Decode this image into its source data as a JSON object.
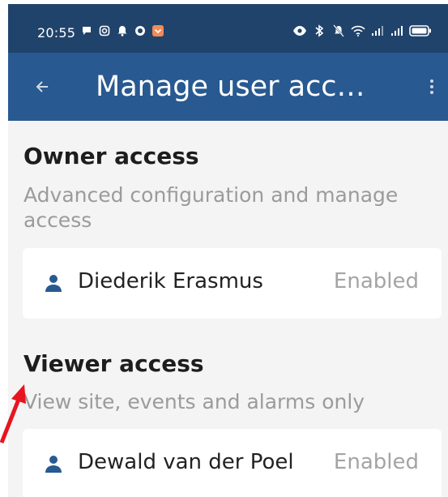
{
  "status_bar": {
    "time": "20:55",
    "left_icons": [
      "chat-bubble-icon",
      "instagram-icon",
      "notification-bell-icon",
      "vpn-icon",
      "app-notification-icon"
    ],
    "right_icons": [
      "eye-icon",
      "bluetooth-icon",
      "do-not-disturb-icon",
      "wifi-icon",
      "signal-icon",
      "signal-2-icon",
      "battery-icon"
    ]
  },
  "app_bar": {
    "title": "Manage user acc…",
    "back_icon": "back-arrow-icon",
    "menu_icon": "more-vert-icon"
  },
  "sections": [
    {
      "title": "Owner access",
      "description": "Advanced configuration and manage access",
      "users": [
        {
          "name": "Diederik Erasmus",
          "status": "Enabled",
          "icon": "person-icon"
        }
      ]
    },
    {
      "title": "Viewer access",
      "description": "View site, events and alarms only",
      "users": [
        {
          "name": "Dewald van der Poel",
          "status": "Enabled",
          "icon": "person-icon"
        }
      ]
    }
  ],
  "colors": {
    "status_bar": "#20436b",
    "app_bar": "#285991",
    "background": "#f4f4f4",
    "person_icon": "#285991",
    "annotation_arrow": "#e8141f"
  }
}
